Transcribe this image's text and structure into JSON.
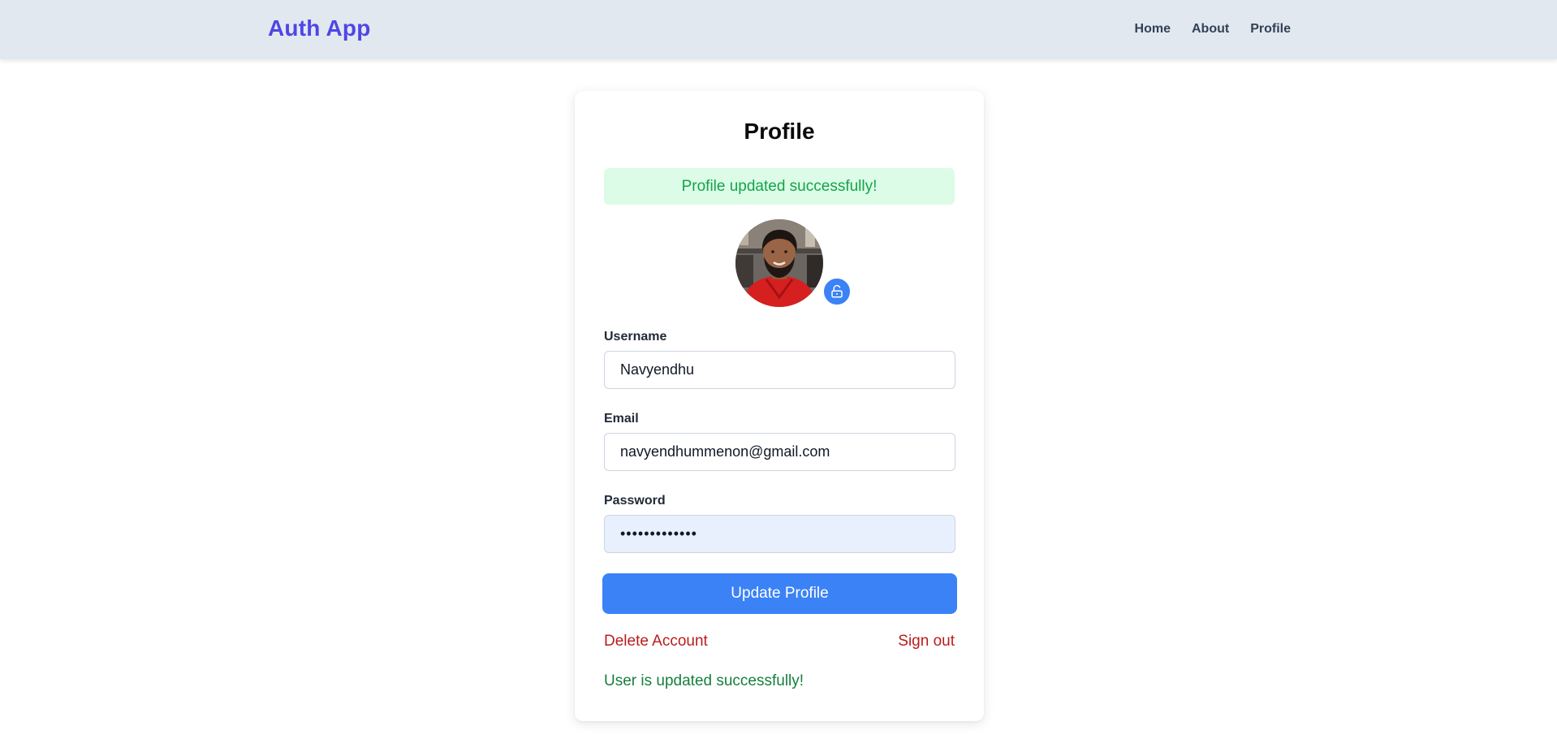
{
  "app": {
    "brand": "Auth App"
  },
  "nav": {
    "items": [
      {
        "label": "Home"
      },
      {
        "label": "About"
      },
      {
        "label": "Profile"
      }
    ]
  },
  "profile": {
    "title": "Profile",
    "alert": "Profile updated successfully!",
    "avatar_badge_icon": "unlock-icon",
    "fields": {
      "username": {
        "label": "Username",
        "value": "Navyendhu"
      },
      "email": {
        "label": "Email",
        "value": "navyendhummenon@gmail.com"
      },
      "password": {
        "label": "Password",
        "value": "•••••••••••••"
      }
    },
    "update_button": "Update Profile",
    "delete_account": "Delete Account",
    "sign_out": "Sign out",
    "status_message": "User is updated successfully!"
  },
  "colors": {
    "brand": "#4f46e5",
    "primary_button": "#3b82f6",
    "success_bg": "#dcfce7",
    "success_text": "#16a34a",
    "danger_text": "#b91c1c",
    "navbar_bg": "#e2e8f0"
  }
}
